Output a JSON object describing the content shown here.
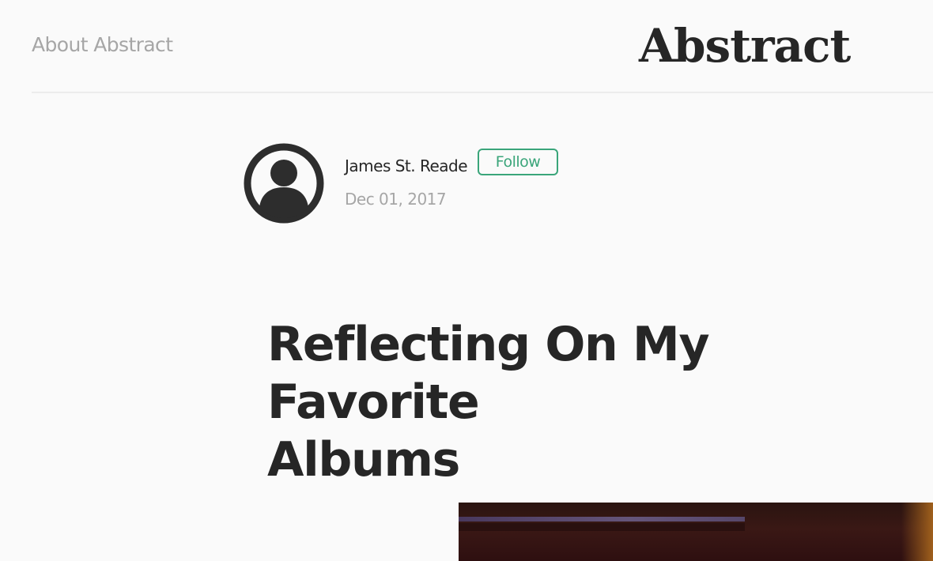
{
  "header": {
    "nav_link": "About Abstract",
    "brand": "Abstract"
  },
  "author": {
    "name": "James St. Reade",
    "follow_label": "Follow",
    "date": "Dec 01, 2017",
    "avatar_icon": "user-circle-icon"
  },
  "post": {
    "title": "Reflecting On My Favorite\nAlbums"
  },
  "colors": {
    "background": "#fafafa",
    "text": "#262626",
    "muted": "#a6a6a6",
    "accent": "#3aa57a"
  }
}
